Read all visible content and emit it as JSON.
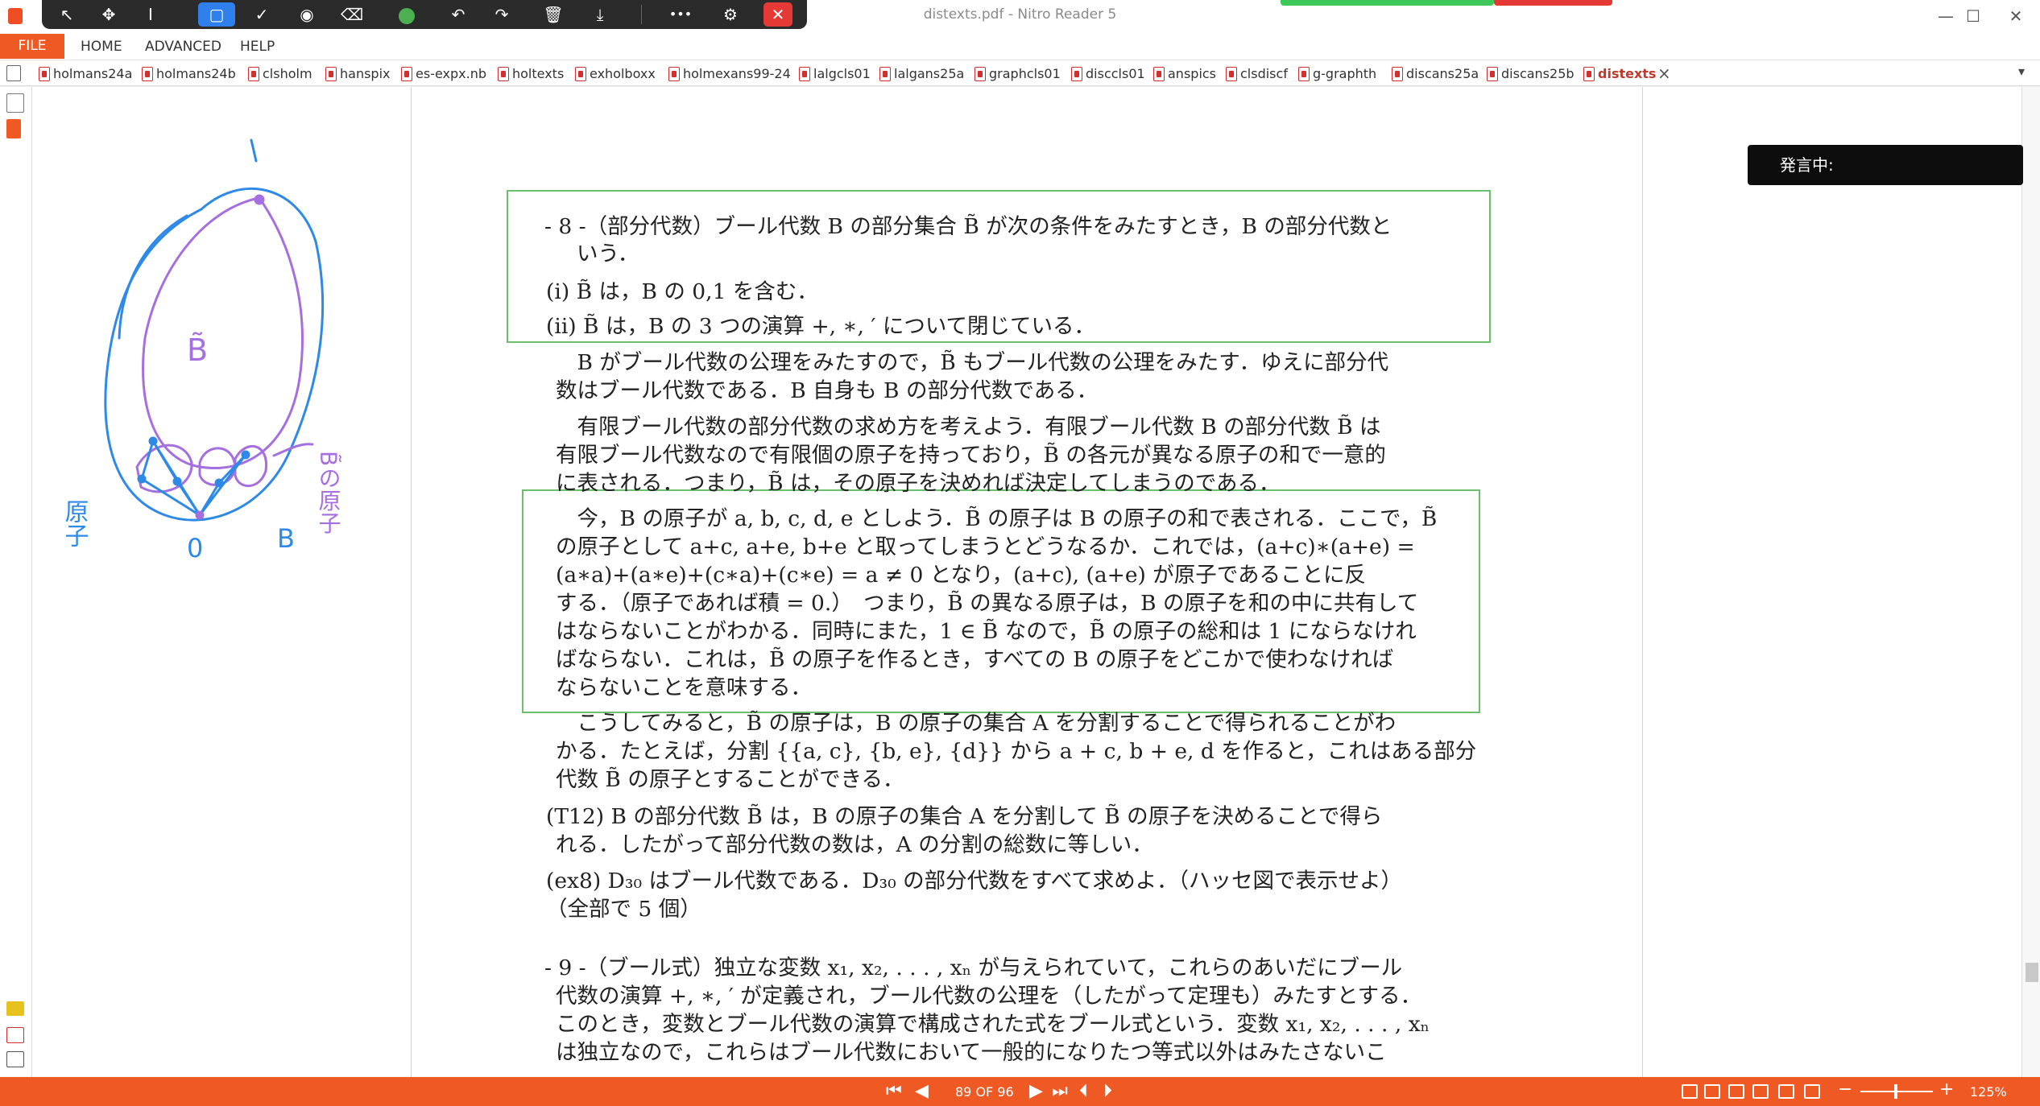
{
  "window": {
    "title": "distexts.pdf - Nitro Reader 5",
    "minimize": "—",
    "maximize": "☐",
    "close": "✕"
  },
  "toolbar": {
    "tools": [
      {
        "name": "pointer-tool-icon",
        "glyph": "↖"
      },
      {
        "name": "move-tool-icon",
        "glyph": "✥"
      },
      {
        "name": "text-cursor-tool-icon",
        "glyph": "I"
      },
      {
        "name": "rectangle-tool-icon",
        "glyph": "▢"
      },
      {
        "name": "check-tool-icon",
        "glyph": "✓"
      },
      {
        "name": "highlighter-tool-icon",
        "glyph": "◉"
      },
      {
        "name": "eraser-tool-icon",
        "glyph": "⌫"
      },
      {
        "name": "color-tool-icon",
        "glyph": ""
      },
      {
        "name": "undo-icon",
        "glyph": "↶"
      },
      {
        "name": "redo-icon",
        "glyph": "↷"
      },
      {
        "name": "trash-icon",
        "glyph": "🗑"
      },
      {
        "name": "download-icon",
        "glyph": "⤓"
      },
      {
        "name": "more-icon",
        "glyph": "•••"
      },
      {
        "name": "user-settings-icon",
        "glyph": "⚙"
      },
      {
        "name": "toolbar-close-icon",
        "glyph": "✕"
      }
    ],
    "accent_color": "#2f80ed"
  },
  "menu": {
    "file": "FILE",
    "home": "HOME",
    "advanced": "ADVANCED",
    "help": "HELP"
  },
  "tabs": [
    "holmans24a",
    "holmans24b",
    "clsholm",
    "hanspix",
    "es-expx.nb",
    "holtexts",
    "exholboxx",
    "holmexans99-24",
    "lalgcls01",
    "lalgans25a",
    "graphcls01",
    "disccls01",
    "anspics",
    "clsdiscf",
    "g-graphth",
    "discans25a",
    "discans25b",
    "distexts"
  ],
  "active_tab": "distexts",
  "speaker_overlay": "発言中:",
  "page_text": {
    "l1": "- 8 -（部分代数）ブール代数 B の部分集合 B̃ が次の条件をみたすとき，B の部分代数と",
    "l2": "いう．",
    "l3": "(i)  B̃ は，B の 0,1 を含む．",
    "l4": "(ii)  B̃ は，B の 3 つの演算 +, ∗, ′ について閉じている．",
    "l5": "　B がブール代数の公理をみたすので，B̃ もブール代数の公理をみたす．ゆえに部分代",
    "l6": "数はブール代数である．B 自身も B の部分代数である．",
    "l7": "　有限ブール代数の部分代数の求め方を考えよう．有限ブール代数 B の部分代数 B̃ は",
    "l8": "有限ブール代数なので有限個の原子を持っており，B̃ の各元が異なる原子の和で一意的",
    "l9": "に表される．つまり，B̃ は，その原子を決めれば決定してしまうのである．",
    "l10": "　今，B の原子が a, b, c, d, e としよう．B̃ の原子は B の原子の和で表される．ここで，B̃",
    "l11": "の原子として a+c, a+e, b+e と取ってしまうとどうなるか．これでは，(a+c)∗(a+e) =",
    "l12": "(a∗a)+(a∗e)+(c∗a)+(c∗e) = a ≠ 0 となり，(a+c), (a+e) が原子であることに反",
    "l13": "する．（原子であれば積 = 0.）　つまり，B̃ の異なる原子は，B の原子を和の中に共有して",
    "l14": "はならないことがわかる．同時にまた，1 ∈ B̃ なので，B̃ の原子の総和は 1 にならなけれ",
    "l15": "ばならない．これは，B̃ の原子を作るとき，すべての B の原子をどこかで使わなければ",
    "l16": "ならないことを意味する．",
    "l17": "　こうしてみると，B̃ の原子は，B の原子の集合 A を分割することで得られることがわ",
    "l18": "かる．たとえば，分割 {{a, c}, {b, e}, {d}} から a + c, b + e, d を作ると，これはある部分",
    "l19": "代数 B̃ の原子とすることができる．",
    "l20": "(T12)  B の部分代数 B̃ は，B の原子の集合 A を分割して B̃ の原子を決めることで得ら",
    "l21": "れる．したがって部分代数の数は，A の分割の総数に等しい．",
    "l22": "(ex8)  D₃₀ はブール代数である．D₃₀ の部分代数をすべて求めよ．（ハッセ図で表示せよ）",
    "l23": "（全部で 5 個）",
    "l24": "- 9 -（ブール式）独立な変数 x₁, x₂, . . . , xₙ が与えられていて，これらのあいだにブール",
    "l25": "代数の演算 +, ∗, ′ が定義され，ブール代数の公理を（したがって定理も）みたすとする．",
    "l26": "このとき，変数とブール代数の演算で構成された式をブール式という．変数 x₁, x₂, . . . , xₙ",
    "l27": "は独立なので，これらはブール代数において一般的になりたつ等式以外はみたさないこ"
  },
  "handwriting": {
    "label_top": "1",
    "label_bottom": "0",
    "label_b_tilde": "B̃",
    "label_b": "B",
    "label_atoms_left": "原子",
    "label_atoms_right": "B̃の原子"
  },
  "status": {
    "page_indicator": "89 OF 96",
    "zoom": "125%"
  },
  "colors": {
    "accent": "#ef5a24",
    "highlight_box": "#6cbf6c",
    "ink_blue": "#2e8ae6",
    "ink_purple": "#a66fe0"
  }
}
